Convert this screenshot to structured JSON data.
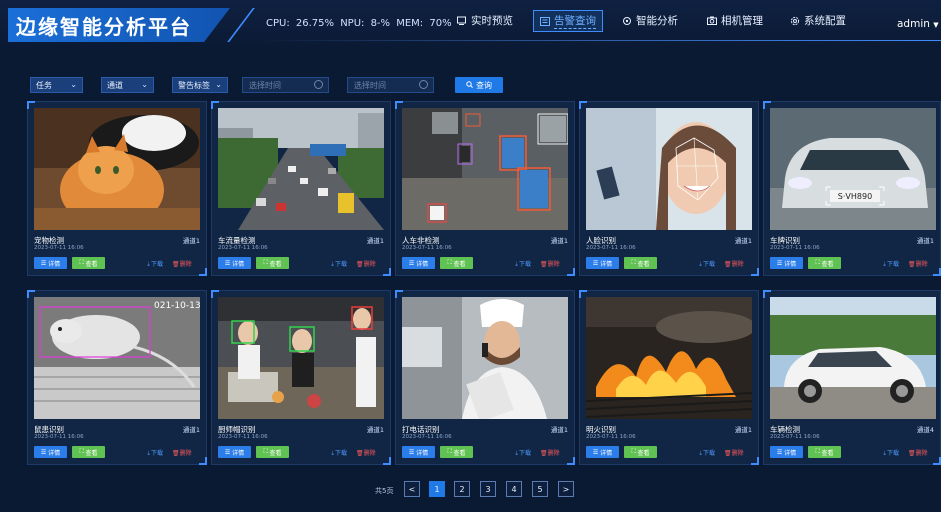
{
  "app": {
    "title": "边缘智能分析平台"
  },
  "metrics": "CPU: 26.75%  NPU: 8-%  MEM: 70%",
  "nav": {
    "items": [
      {
        "label": "实时预览",
        "icon": "live-preview-icon"
      },
      {
        "label": "告警查询",
        "icon": "alarm-query-icon",
        "active": true
      },
      {
        "label": "智能分析",
        "icon": "smart-analysis-icon"
      },
      {
        "label": "相机管理",
        "icon": "camera-icon"
      },
      {
        "label": "系统配置",
        "icon": "settings-icon"
      }
    ],
    "user": "admin"
  },
  "filters": {
    "task": "任务",
    "channel": "通道",
    "alarm_tag": "警告标签",
    "start_placeholder": "选择时间",
    "end_placeholder": "选择时间",
    "query_label": "查询"
  },
  "card_buttons": {
    "detail": "详情",
    "view": "查看",
    "download": "下载",
    "delete": "删除"
  },
  "cards": [
    {
      "name": "宠物检测",
      "channel": "通道1",
      "date": "2023-07-11 16:06"
    },
    {
      "name": "车流量检测",
      "channel": "通道1",
      "date": "2023-07-11 16:06"
    },
    {
      "name": "人车非检测",
      "channel": "通道1",
      "date": "2023-07-11 16:06"
    },
    {
      "name": "人脸识别",
      "channel": "通道1",
      "date": "2023-07-11 16:06"
    },
    {
      "name": "车牌识别",
      "channel": "通道1",
      "date": "2023-07-11 16:06"
    },
    {
      "name": "鼠患识别",
      "channel": "通道1",
      "date": "2023-07-11 16:06"
    },
    {
      "name": "厨师帽识别",
      "channel": "通道1",
      "date": "2023-07-11 16:06"
    },
    {
      "name": "打电话识别",
      "channel": "通道1",
      "date": "2023-07-11 16:06"
    },
    {
      "name": "明火识别",
      "channel": "通道1",
      "date": "2023-07-11 16:06"
    },
    {
      "name": "车辆检测",
      "channel": "通道4",
      "date": "2023-07-11 16:06"
    }
  ],
  "image_text": {
    "plate": "S·VH890",
    "rat_timestamp": "021-10-13"
  },
  "pagination": {
    "total": "共5页",
    "prev": "<",
    "pages": [
      "1",
      "2",
      "3",
      "4",
      "5"
    ],
    "next": ">",
    "current": "1"
  },
  "colors": {
    "accent": "#1f7ae8",
    "view_green": "#5fc252",
    "delete_red": "#ff5b5b",
    "bg": "#0b1a33"
  }
}
